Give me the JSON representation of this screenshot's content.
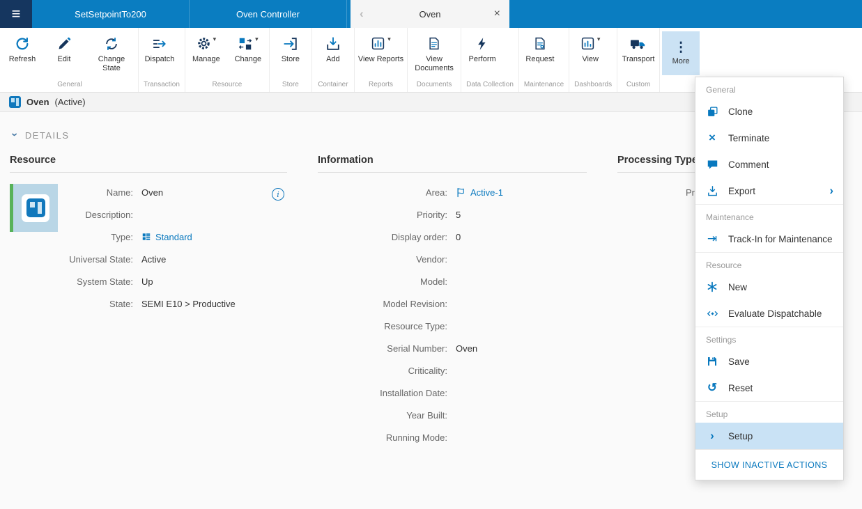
{
  "topbar": {
    "tabs": [
      {
        "label": "SetSetpointTo200"
      },
      {
        "label": "Oven Controller"
      },
      {
        "label": "Oven"
      }
    ]
  },
  "ribbon": {
    "groups": [
      {
        "label": "General",
        "buttons": [
          {
            "label": "Refresh"
          },
          {
            "label": "Edit"
          },
          {
            "label": "Change State"
          }
        ]
      },
      {
        "label": "Transaction",
        "buttons": [
          {
            "label": "Dispatch"
          }
        ]
      },
      {
        "label": "Resource",
        "buttons": [
          {
            "label": "Manage"
          },
          {
            "label": "Change"
          }
        ]
      },
      {
        "label": "Store",
        "buttons": [
          {
            "label": "Store"
          }
        ]
      },
      {
        "label": "Container",
        "buttons": [
          {
            "label": "Add"
          }
        ]
      },
      {
        "label": "Reports",
        "buttons": [
          {
            "label": "View Reports"
          }
        ]
      },
      {
        "label": "Documents",
        "buttons": [
          {
            "label": "View Documents"
          }
        ]
      },
      {
        "label": "Data Collection",
        "buttons": [
          {
            "label": "Perform"
          }
        ]
      },
      {
        "label": "Maintenance",
        "buttons": [
          {
            "label": "Request"
          }
        ]
      },
      {
        "label": "Dashboards",
        "buttons": [
          {
            "label": "View"
          }
        ]
      },
      {
        "label": "Custom",
        "buttons": [
          {
            "label": "Transport"
          }
        ]
      }
    ],
    "more_label": "More"
  },
  "title": {
    "name": "Oven",
    "state": "(Active)"
  },
  "details": {
    "label": "DETAILS"
  },
  "sections": {
    "resource": {
      "header": "Resource",
      "fields": [
        {
          "label": "Name:",
          "value": "Oven"
        },
        {
          "label": "Description:",
          "value": ""
        },
        {
          "label": "Type:",
          "value": "Standard"
        },
        {
          "label": "Universal State:",
          "value": "Active"
        },
        {
          "label": "System State:",
          "value": "Up"
        },
        {
          "label": "State:",
          "value": "SEMI E10 > Productive"
        }
      ]
    },
    "information": {
      "header": "Information",
      "fields": [
        {
          "label": "Area:",
          "value": "Active-1"
        },
        {
          "label": "Priority:",
          "value": "5"
        },
        {
          "label": "Display order:",
          "value": "0"
        },
        {
          "label": "Vendor:",
          "value": ""
        },
        {
          "label": "Model:",
          "value": ""
        },
        {
          "label": "Model Revision:",
          "value": ""
        },
        {
          "label": "Resource Type:",
          "value": ""
        },
        {
          "label": "Serial Number:",
          "value": "Oven"
        },
        {
          "label": "Criticality:",
          "value": ""
        },
        {
          "label": "Installation Date:",
          "value": ""
        },
        {
          "label": "Year Built:",
          "value": ""
        },
        {
          "label": "Running Mode:",
          "value": ""
        }
      ]
    },
    "processing": {
      "header": "Processing Type",
      "partial": "Pro"
    }
  },
  "menu": {
    "groups": [
      {
        "label": "General",
        "items": [
          {
            "label": "Clone"
          },
          {
            "label": "Terminate"
          },
          {
            "label": "Comment"
          },
          {
            "label": "Export"
          }
        ]
      },
      {
        "label": "Maintenance",
        "items": [
          {
            "label": "Track-In for Maintenance"
          }
        ]
      },
      {
        "label": "Resource",
        "items": [
          {
            "label": "New"
          },
          {
            "label": "Evaluate Dispatchable"
          }
        ]
      },
      {
        "label": "Settings",
        "items": [
          {
            "label": "Save"
          },
          {
            "label": "Reset"
          }
        ]
      },
      {
        "label": "Setup",
        "items": [
          {
            "label": "Setup"
          }
        ]
      }
    ],
    "footer": "SHOW INACTIVE ACTIONS"
  },
  "icons": {
    "hamburger": "≡",
    "more": "⋮",
    "caret": "▾",
    "close": "×",
    "chevron_left": "‹",
    "chevron_right": "›",
    "terminate": "×",
    "track_in": "⇥",
    "reset": "↺",
    "info": "i"
  },
  "colors": {
    "topbar": "#0a7dc1",
    "accent": "#0878be",
    "navy": "#16365c",
    "highlight": "#c9e2f5",
    "green_bar": "#57b259"
  }
}
